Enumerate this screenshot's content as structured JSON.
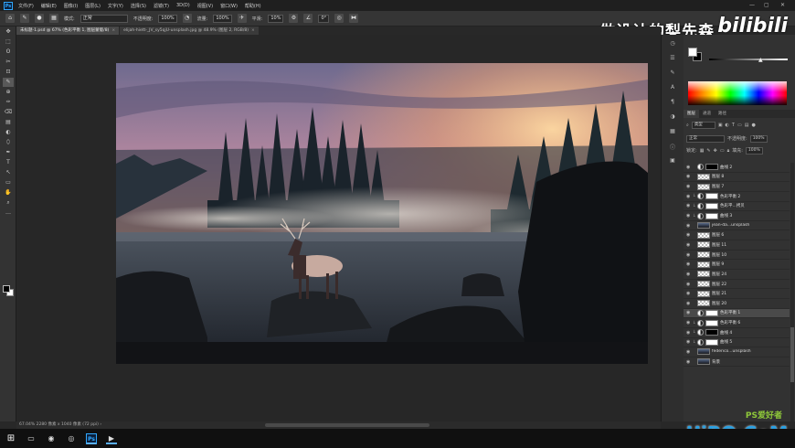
{
  "menubar": {
    "items": [
      "文件(F)",
      "编辑(E)",
      "图像(I)",
      "图层(L)",
      "文字(Y)",
      "选择(S)",
      "滤镜(T)",
      "3D(D)",
      "视图(V)",
      "窗口(W)",
      "帮助(H)"
    ],
    "window_controls": [
      "—",
      "▢",
      "✕"
    ]
  },
  "optionsbar": {
    "mode_label": "模式:",
    "mode_value": "正常",
    "opacity_label": "不透明度:",
    "opacity_value": "100%",
    "flow_label": "流量:",
    "flow_value": "100%",
    "smooth_label": "平滑:",
    "smooth_value": "10%",
    "angle_value": "0°"
  },
  "watermark": {
    "title": "做设计的梨先森",
    "brand": "bilibili",
    "site": "UiBQ.CoM",
    "site_sub": "PS爱好者"
  },
  "tabs": [
    {
      "label": "未标题-1.psd @ 67% (色彩平衡 1, 图层蒙版/8)",
      "active": true
    },
    {
      "label": "elijah-hiett-_JV_sy5qjU-unsplash.jpg @ 48.9% (图层 2, RGB/8)",
      "active": false
    }
  ],
  "toolbar": {
    "tools": [
      "✥",
      "⬚",
      "ʘ",
      "✂",
      "⊡",
      "✎",
      "⊕",
      "✑",
      "⌫",
      "▤",
      "◐",
      "⬯",
      "✒",
      "T",
      "↖",
      "▭",
      "✋",
      "⌕",
      "…"
    ]
  },
  "statusbar": {
    "text": "67.04%   2280 像素 x 1040 像素 (72 ppi)   ›"
  },
  "layers_panel": {
    "tabs": [
      "图层",
      "通道",
      "路径"
    ],
    "filter_label": "类型",
    "blend_mode": "正常",
    "opacity_label": "不透明度:",
    "opacity_value": "100%",
    "lock_label": "锁定:",
    "fill_label": "填充:",
    "fill_value": "100%",
    "layers": [
      {
        "name": "曲线 2",
        "thumb": "black",
        "clip": false,
        "adj": true,
        "selected": false
      },
      {
        "name": "图层 8",
        "thumb": "checker",
        "clip": false,
        "adj": false,
        "selected": false
      },
      {
        "name": "图层 7",
        "thumb": "checker",
        "clip": false,
        "adj": false,
        "selected": false
      },
      {
        "name": "色彩平衡 2",
        "thumb": "white",
        "clip": true,
        "adj": true,
        "selected": false
      },
      {
        "name": "色彩平...拷贝",
        "thumb": "white",
        "clip": true,
        "adj": true,
        "selected": false
      },
      {
        "name": "曲线 3",
        "thumb": "white",
        "clip": true,
        "adj": true,
        "selected": false
      },
      {
        "name": "jean-da...unsplash",
        "thumb": "photo",
        "clip": false,
        "adj": false,
        "selected": false
      },
      {
        "name": "图层 6",
        "thumb": "checker",
        "clip": false,
        "adj": false,
        "selected": false
      },
      {
        "name": "图层 11",
        "thumb": "checker",
        "clip": false,
        "adj": false,
        "selected": false
      },
      {
        "name": "图层 10",
        "thumb": "checker",
        "clip": false,
        "adj": false,
        "selected": false
      },
      {
        "name": "图层 9",
        "thumb": "checker",
        "clip": false,
        "adj": false,
        "selected": false
      },
      {
        "name": "图层 24",
        "thumb": "checker",
        "clip": false,
        "adj": false,
        "selected": false
      },
      {
        "name": "图层 22",
        "thumb": "checker",
        "clip": false,
        "adj": false,
        "selected": false
      },
      {
        "name": "图层 21",
        "thumb": "checker",
        "clip": false,
        "adj": false,
        "selected": false
      },
      {
        "name": "图层 20",
        "thumb": "checker",
        "clip": false,
        "adj": false,
        "selected": false
      },
      {
        "name": "色彩平衡 1",
        "thumb": "white",
        "clip": false,
        "adj": true,
        "selected": true
      },
      {
        "name": "色彩平衡 6",
        "thumb": "white",
        "clip": true,
        "adj": true,
        "selected": false
      },
      {
        "name": "曲线 4",
        "thumb": "black",
        "clip": true,
        "adj": true,
        "selected": false
      },
      {
        "name": "曲线 5",
        "thumb": "white",
        "clip": true,
        "adj": true,
        "selected": false
      },
      {
        "name": "federico...unsplash",
        "thumb": "photo",
        "clip": false,
        "adj": false,
        "selected": false
      },
      {
        "name": "背景",
        "thumb": "photo",
        "clip": false,
        "adj": false,
        "selected": false
      }
    ]
  },
  "taskbar": {
    "items": [
      "⊞",
      "▭",
      "◉",
      "◎",
      "Ps",
      "▶"
    ]
  },
  "colors": {
    "accent": "#31a8ff",
    "panel_bg": "#323232",
    "canvas_bg": "#272727"
  }
}
